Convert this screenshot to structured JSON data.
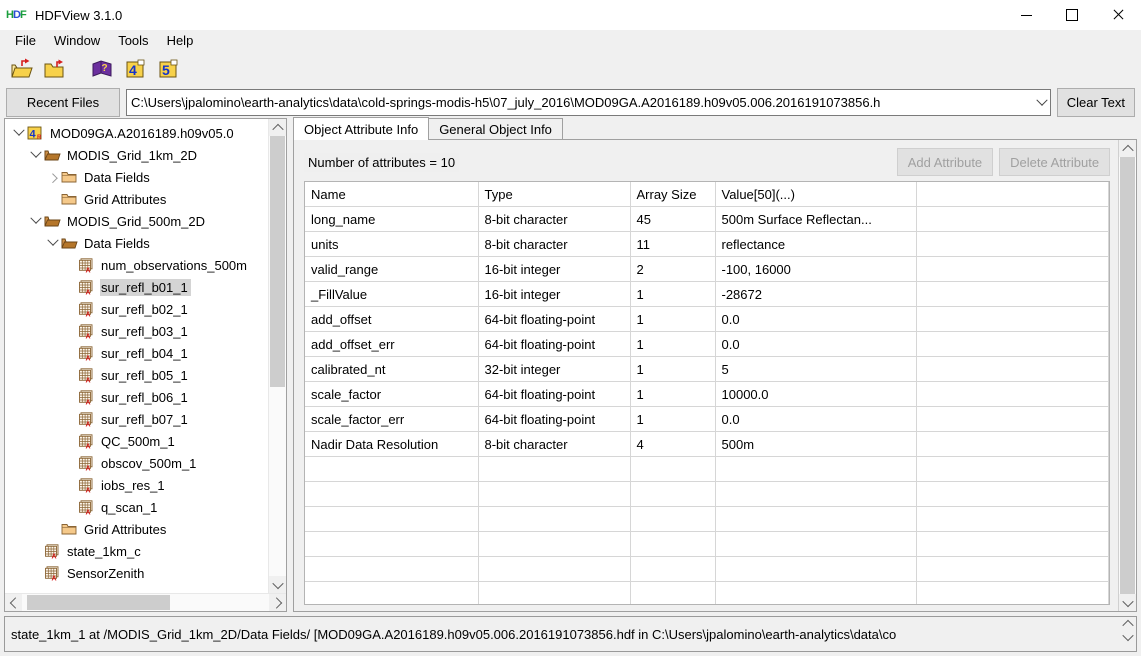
{
  "window": {
    "title": "HDFView 3.1.0",
    "logo_icon": "hdf-logo-icon",
    "controls": [
      {
        "name": "minimize-button",
        "icon": "minimize-icon"
      },
      {
        "name": "maximize-button",
        "icon": "maximize-icon"
      },
      {
        "name": "close-button",
        "icon": "close-icon"
      }
    ]
  },
  "menubar": {
    "items": [
      {
        "label": "File"
      },
      {
        "label": "Window"
      },
      {
        "label": "Tools"
      },
      {
        "label": "Help"
      }
    ]
  },
  "toolbar": {
    "buttons": [
      {
        "name": "open-file-button",
        "icon": "open-folder-icon"
      },
      {
        "name": "close-file-button",
        "icon": "closed-folder-icon"
      },
      {
        "name": "help-button",
        "icon": "purple-book-question-icon"
      },
      {
        "name": "hdf4-button",
        "icon": "hdf4-icon",
        "label": "4"
      },
      {
        "name": "hdf5-button",
        "icon": "hdf5-icon",
        "label": "5"
      }
    ]
  },
  "pathbar": {
    "recent_files_label": "Recent Files",
    "path_value": "C:\\Users\\jpalomino\\earth-analytics\\data\\cold-springs-modis-h5\\07_july_2016\\MOD09GA.A2016189.h09v05.006.2016191073856.h",
    "clear_text_label": "Clear Text",
    "dropdown_icon": "chevron-down-icon"
  },
  "tree": {
    "nodes": [
      {
        "label": "MOD09GA.A2016189.h09v05.0",
        "depth": 0,
        "icon": "hdf4-file-icon",
        "twisty": "down",
        "selected": false
      },
      {
        "label": "MODIS_Grid_1km_2D",
        "depth": 1,
        "icon": "folder-open-icon",
        "twisty": "down",
        "selected": false
      },
      {
        "label": "Data Fields",
        "depth": 2,
        "icon": "folder-closed-icon",
        "twisty": "right",
        "selected": false
      },
      {
        "label": "Grid Attributes",
        "depth": 2,
        "icon": "folder-closed-icon",
        "twisty": "none",
        "selected": false
      },
      {
        "label": "MODIS_Grid_500m_2D",
        "depth": 1,
        "icon": "folder-open-icon",
        "twisty": "down",
        "selected": false
      },
      {
        "label": "Data Fields",
        "depth": 2,
        "icon": "folder-open-icon",
        "twisty": "down",
        "selected": false
      },
      {
        "label": "num_observations_500m",
        "depth": 3,
        "icon": "dataset-icon",
        "twisty": "none",
        "selected": false
      },
      {
        "label": "sur_refl_b01_1",
        "depth": 3,
        "icon": "dataset-icon",
        "twisty": "none",
        "selected": true
      },
      {
        "label": "sur_refl_b02_1",
        "depth": 3,
        "icon": "dataset-icon",
        "twisty": "none",
        "selected": false
      },
      {
        "label": "sur_refl_b03_1",
        "depth": 3,
        "icon": "dataset-icon",
        "twisty": "none",
        "selected": false
      },
      {
        "label": "sur_refl_b04_1",
        "depth": 3,
        "icon": "dataset-icon",
        "twisty": "none",
        "selected": false
      },
      {
        "label": "sur_refl_b05_1",
        "depth": 3,
        "icon": "dataset-icon",
        "twisty": "none",
        "selected": false
      },
      {
        "label": "sur_refl_b06_1",
        "depth": 3,
        "icon": "dataset-icon",
        "twisty": "none",
        "selected": false
      },
      {
        "label": "sur_refl_b07_1",
        "depth": 3,
        "icon": "dataset-icon",
        "twisty": "none",
        "selected": false
      },
      {
        "label": "QC_500m_1",
        "depth": 3,
        "icon": "dataset-icon",
        "twisty": "none",
        "selected": false
      },
      {
        "label": "obscov_500m_1",
        "depth": 3,
        "icon": "dataset-icon",
        "twisty": "none",
        "selected": false
      },
      {
        "label": "iobs_res_1",
        "depth": 3,
        "icon": "dataset-icon",
        "twisty": "none",
        "selected": false
      },
      {
        "label": "q_scan_1",
        "depth": 3,
        "icon": "dataset-icon",
        "twisty": "none",
        "selected": false
      },
      {
        "label": "Grid Attributes",
        "depth": 2,
        "icon": "folder-closed-icon",
        "twisty": "none",
        "selected": false
      },
      {
        "label": "state_1km_c",
        "depth": 1,
        "icon": "dataset-icon",
        "twisty": "none",
        "selected": false
      },
      {
        "label": "SensorZenith",
        "depth": 1,
        "icon": "dataset-icon",
        "twisty": "none",
        "selected": false
      }
    ]
  },
  "tabs": [
    {
      "label": "Object Attribute Info",
      "active": true
    },
    {
      "label": "General Object Info",
      "active": false
    }
  ],
  "attributes_panel": {
    "count_label": "Number of attributes = 10",
    "add_button_label": "Add Attribute",
    "delete_button_label": "Delete Attribute",
    "columns": [
      "Name",
      "Type",
      "Array Size",
      "Value[50](...)",
      ""
    ],
    "rows": [
      [
        "long_name",
        "8-bit character",
        "45",
        "500m Surface Reflectan...",
        ""
      ],
      [
        "units",
        "8-bit character",
        "11",
        "reflectance",
        ""
      ],
      [
        "valid_range",
        "16-bit integer",
        "2",
        "-100, 16000",
        ""
      ],
      [
        "_FillValue",
        "16-bit integer",
        "1",
        "-28672",
        ""
      ],
      [
        "add_offset",
        "64-bit floating-point",
        "1",
        "0.0",
        ""
      ],
      [
        "add_offset_err",
        "64-bit floating-point",
        "1",
        "0.0",
        ""
      ],
      [
        "calibrated_nt",
        "32-bit integer",
        "1",
        "5",
        ""
      ],
      [
        "scale_factor",
        "64-bit floating-point",
        "1",
        "10000.0",
        ""
      ],
      [
        "scale_factor_err",
        "64-bit floating-point",
        "1",
        "0.0",
        ""
      ],
      [
        "Nadir Data Resolution",
        "8-bit character",
        "4",
        "500m",
        ""
      ],
      [
        "",
        "",
        "",
        "",
        ""
      ],
      [
        "",
        "",
        "",
        "",
        ""
      ],
      [
        "",
        "",
        "",
        "",
        ""
      ],
      [
        "",
        "",
        "",
        "",
        ""
      ],
      [
        "",
        "",
        "",
        "",
        ""
      ],
      [
        "",
        "",
        "",
        "",
        ""
      ]
    ]
  },
  "statusbar": {
    "text": "state_1km_1  at /MODIS_Grid_1km_2D/Data Fields/  [MOD09GA.A2016189.h09v05.006.2016191073856.hdf  in  C:\\Users\\jpalomino\\earth-analytics\\data\\co"
  },
  "colors": {
    "window_bg": "#f0f0f0",
    "panel_bg": "#ffffff",
    "selection": "#d4d4d4",
    "border": "#a0a0a0",
    "disabled_text": "#a0a0a0",
    "folder_open": "#b5762a",
    "folder_closed": "#f5c98a",
    "dataset_grid": "#8a6434",
    "accent_red": "#d61f1f"
  }
}
